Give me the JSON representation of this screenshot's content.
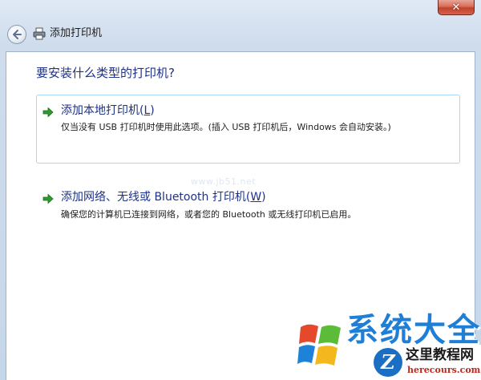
{
  "window": {
    "title": "添加打印机",
    "close_label": "✕"
  },
  "main": {
    "heading": "要安装什么类型的打印机?",
    "options": [
      {
        "title": "添加本地打印机(",
        "accel": "L",
        "title_end": ")",
        "description": "仅当没有 USB 打印机时使用此选项。(插入 USB 打印机后，Windows 会自动安装。)",
        "icon": "green-arrow-icon",
        "selected": true
      },
      {
        "title": "添加网络、无线或 Bluetooth 打印机(",
        "accel": "W",
        "title_end": ")",
        "description": "确保您的计算机已连接到网络，或者您的 Bluetooth 或无线打印机已启用。",
        "icon": "green-arrow-icon",
        "selected": false
      }
    ]
  },
  "overlay": {
    "logo_text": "系统大全",
    "site_name": "这里教程网",
    "site_url": "herecours.com",
    "colors": {
      "accent": "#1e3287",
      "logo_blue": "#1f7fd6",
      "url_red": "#c0281b"
    }
  }
}
